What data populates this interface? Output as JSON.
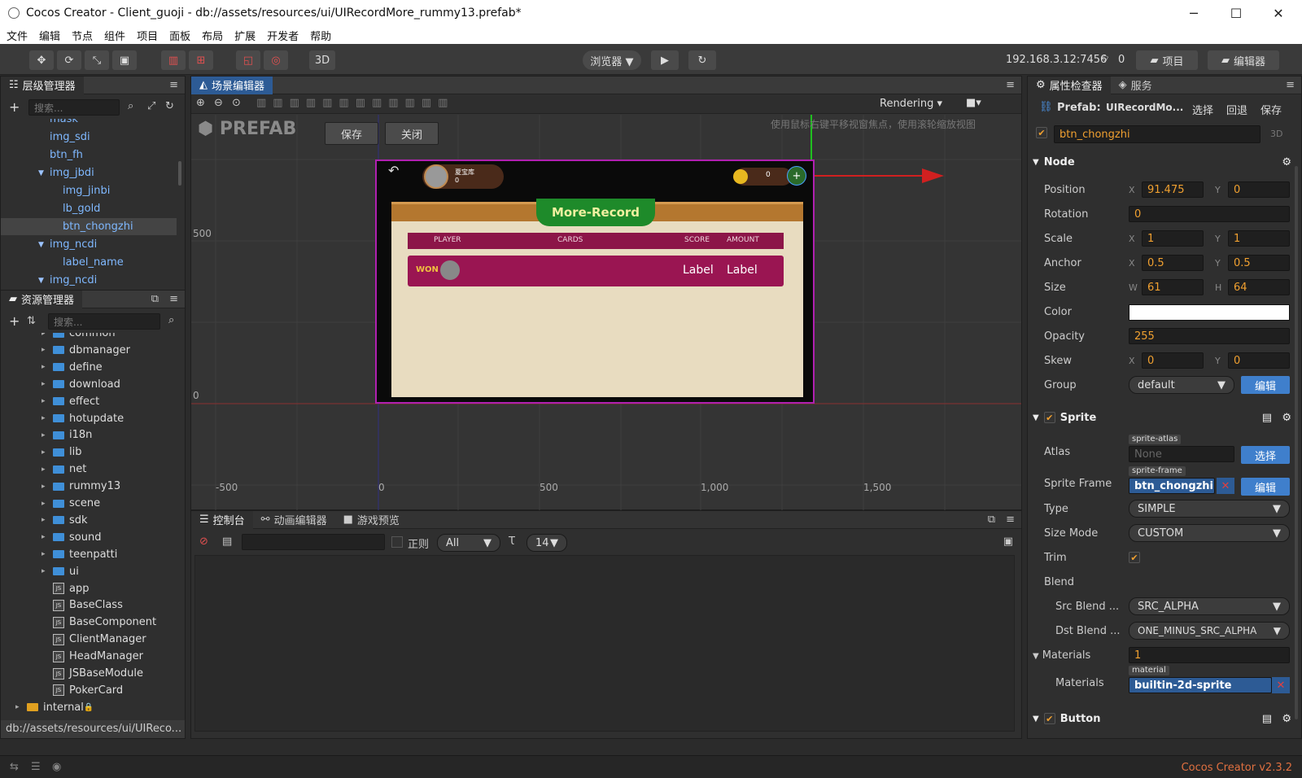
{
  "window": {
    "title": "Cocos Creator - Client_guoji - db://assets/resources/ui/UIRecordMore_rummy13.prefab*",
    "minimize": "─",
    "maximize": "☐",
    "close": "✕"
  },
  "menu": [
    "文件",
    "编辑",
    "节点",
    "组件",
    "项目",
    "面板",
    "布局",
    "扩展",
    "开发者",
    "帮助"
  ],
  "toolbar": {
    "mode3d": "3D",
    "browser": "浏览器 ▼",
    "ip": "192.168.3.12:7456",
    "wifi_count": "0",
    "project_btn": "项目",
    "editor_btn": "编辑器"
  },
  "hierarchy": {
    "tab": "层级管理器",
    "search_placeholder": "搜索...",
    "items": [
      {
        "label": "mask",
        "indent": 60,
        "arrow": ""
      },
      {
        "label": "img_sdi",
        "indent": 60,
        "arrow": ""
      },
      {
        "label": "btn_fh",
        "indent": 60,
        "arrow": ""
      },
      {
        "label": "img_jbdi",
        "indent": 60,
        "arrow": "▼"
      },
      {
        "label": "img_jinbi",
        "indent": 76,
        "arrow": ""
      },
      {
        "label": "lb_gold",
        "indent": 76,
        "arrow": ""
      },
      {
        "label": "btn_chongzhi",
        "indent": 76,
        "arrow": "",
        "selected": true
      },
      {
        "label": "img_ncdi",
        "indent": 60,
        "arrow": "▼"
      },
      {
        "label": "label_name",
        "indent": 76,
        "arrow": ""
      },
      {
        "label": "img_ncdi",
        "indent": 60,
        "arrow": "▼"
      }
    ]
  },
  "assets": {
    "tab": "资源管理器",
    "search_placeholder": "搜索...",
    "items": [
      {
        "label": "common",
        "type": "folder",
        "indent": 64
      },
      {
        "label": "dbmanager",
        "type": "folder",
        "indent": 64
      },
      {
        "label": "define",
        "type": "folder",
        "indent": 64
      },
      {
        "label": "download",
        "type": "folder",
        "indent": 64
      },
      {
        "label": "effect",
        "type": "folder",
        "indent": 64
      },
      {
        "label": "hotupdate",
        "type": "folder",
        "indent": 64
      },
      {
        "label": "i18n",
        "type": "folder",
        "indent": 64
      },
      {
        "label": "lib",
        "type": "folder",
        "indent": 64
      },
      {
        "label": "net",
        "type": "folder",
        "indent": 64
      },
      {
        "label": "rummy13",
        "type": "folder",
        "indent": 64
      },
      {
        "label": "scene",
        "type": "folder",
        "indent": 64
      },
      {
        "label": "sdk",
        "type": "folder",
        "indent": 64
      },
      {
        "label": "sound",
        "type": "folder",
        "indent": 64
      },
      {
        "label": "teenpatti",
        "type": "folder",
        "indent": 64
      },
      {
        "label": "ui",
        "type": "folder",
        "indent": 64
      },
      {
        "label": "app",
        "type": "js",
        "indent": 64
      },
      {
        "label": "BaseClass",
        "type": "js",
        "indent": 64
      },
      {
        "label": "BaseComponent",
        "type": "js",
        "indent": 64
      },
      {
        "label": "ClientManager",
        "type": "js",
        "indent": 64
      },
      {
        "label": "HeadManager",
        "type": "js",
        "indent": 64
      },
      {
        "label": "JSBaseModule",
        "type": "js",
        "indent": 64
      },
      {
        "label": "PokerCard",
        "type": "js",
        "indent": 64
      },
      {
        "label": "internal",
        "type": "internal",
        "indent": 32
      }
    ],
    "path": "db://assets/resources/ui/UIReco..."
  },
  "scene": {
    "tab": "场景编辑器",
    "rendering": "Rendering",
    "prefab_logo": "PREFAB",
    "save": "保存",
    "close": "关闭",
    "hint": "使用鼠标右键平移视窗焦点，使用滚轮缩放视图",
    "axis_y": [
      "500",
      "0"
    ],
    "axis_x": [
      "-500",
      "0",
      "500",
      "1,000",
      "1,500"
    ],
    "game": {
      "title": "More-Record",
      "player_name": "夏宝库",
      "player_score": "0",
      "coin": "0",
      "headers": [
        "PLAYER",
        "CARDS",
        "SCORE",
        "AMOUNT"
      ],
      "won": "WON",
      "label1": "Label",
      "label2": "Label"
    }
  },
  "console": {
    "tabs": [
      "控制台",
      "动画编辑器",
      "游戏预览"
    ],
    "regex": "正则",
    "filter": "All",
    "font_size": "14"
  },
  "inspector": {
    "tabs": [
      "属性检查器",
      "服务"
    ],
    "prefab_label": "Prefab:",
    "prefab_name": "UIRecordMo...",
    "select": "选择",
    "revert": "回退",
    "save": "保存",
    "node_name": "btn_chongzhi",
    "mode3d": "3D",
    "node_section": "Node",
    "position": {
      "label": "Position",
      "x": "91.475",
      "y": "0"
    },
    "rotation": {
      "label": "Rotation",
      "v": "0"
    },
    "scale": {
      "label": "Scale",
      "x": "1",
      "y": "1"
    },
    "anchor": {
      "label": "Anchor",
      "x": "0.5",
      "y": "0.5"
    },
    "size": {
      "label": "Size",
      "w": "61",
      "h": "64"
    },
    "color": {
      "label": "Color",
      "value": "#ffffff"
    },
    "opacity": {
      "label": "Opacity",
      "v": "255"
    },
    "skew": {
      "label": "Skew",
      "x": "0",
      "y": "0"
    },
    "group": {
      "label": "Group",
      "v": "default",
      "edit": "编辑"
    },
    "sprite_section": "Sprite",
    "atlas": {
      "label": "Atlas",
      "tag": "sprite-atlas",
      "v": "None",
      "btn": "选择"
    },
    "sprite_frame": {
      "label": "Sprite Frame",
      "tag": "sprite-frame",
      "v": "btn_chongzhi",
      "btn": "编辑"
    },
    "type": {
      "label": "Type",
      "v": "SIMPLE"
    },
    "size_mode": {
      "label": "Size Mode",
      "v": "CUSTOM"
    },
    "trim": {
      "label": "Trim"
    },
    "blend": {
      "label": "Blend"
    },
    "src_blend": {
      "label": "Src Blend ...",
      "v": "SRC_ALPHA"
    },
    "dst_blend": {
      "label": "Dst Blend ...",
      "v": "ONE_MINUS_SRC_ALPHA"
    },
    "materials_count": {
      "label": "Materials",
      "v": "1"
    },
    "materials": {
      "label": "Materials",
      "tag": "material",
      "v": "builtin-2d-sprite"
    },
    "button_section": "Button"
  },
  "status": {
    "version": "Cocos Creator v2.3.2"
  }
}
